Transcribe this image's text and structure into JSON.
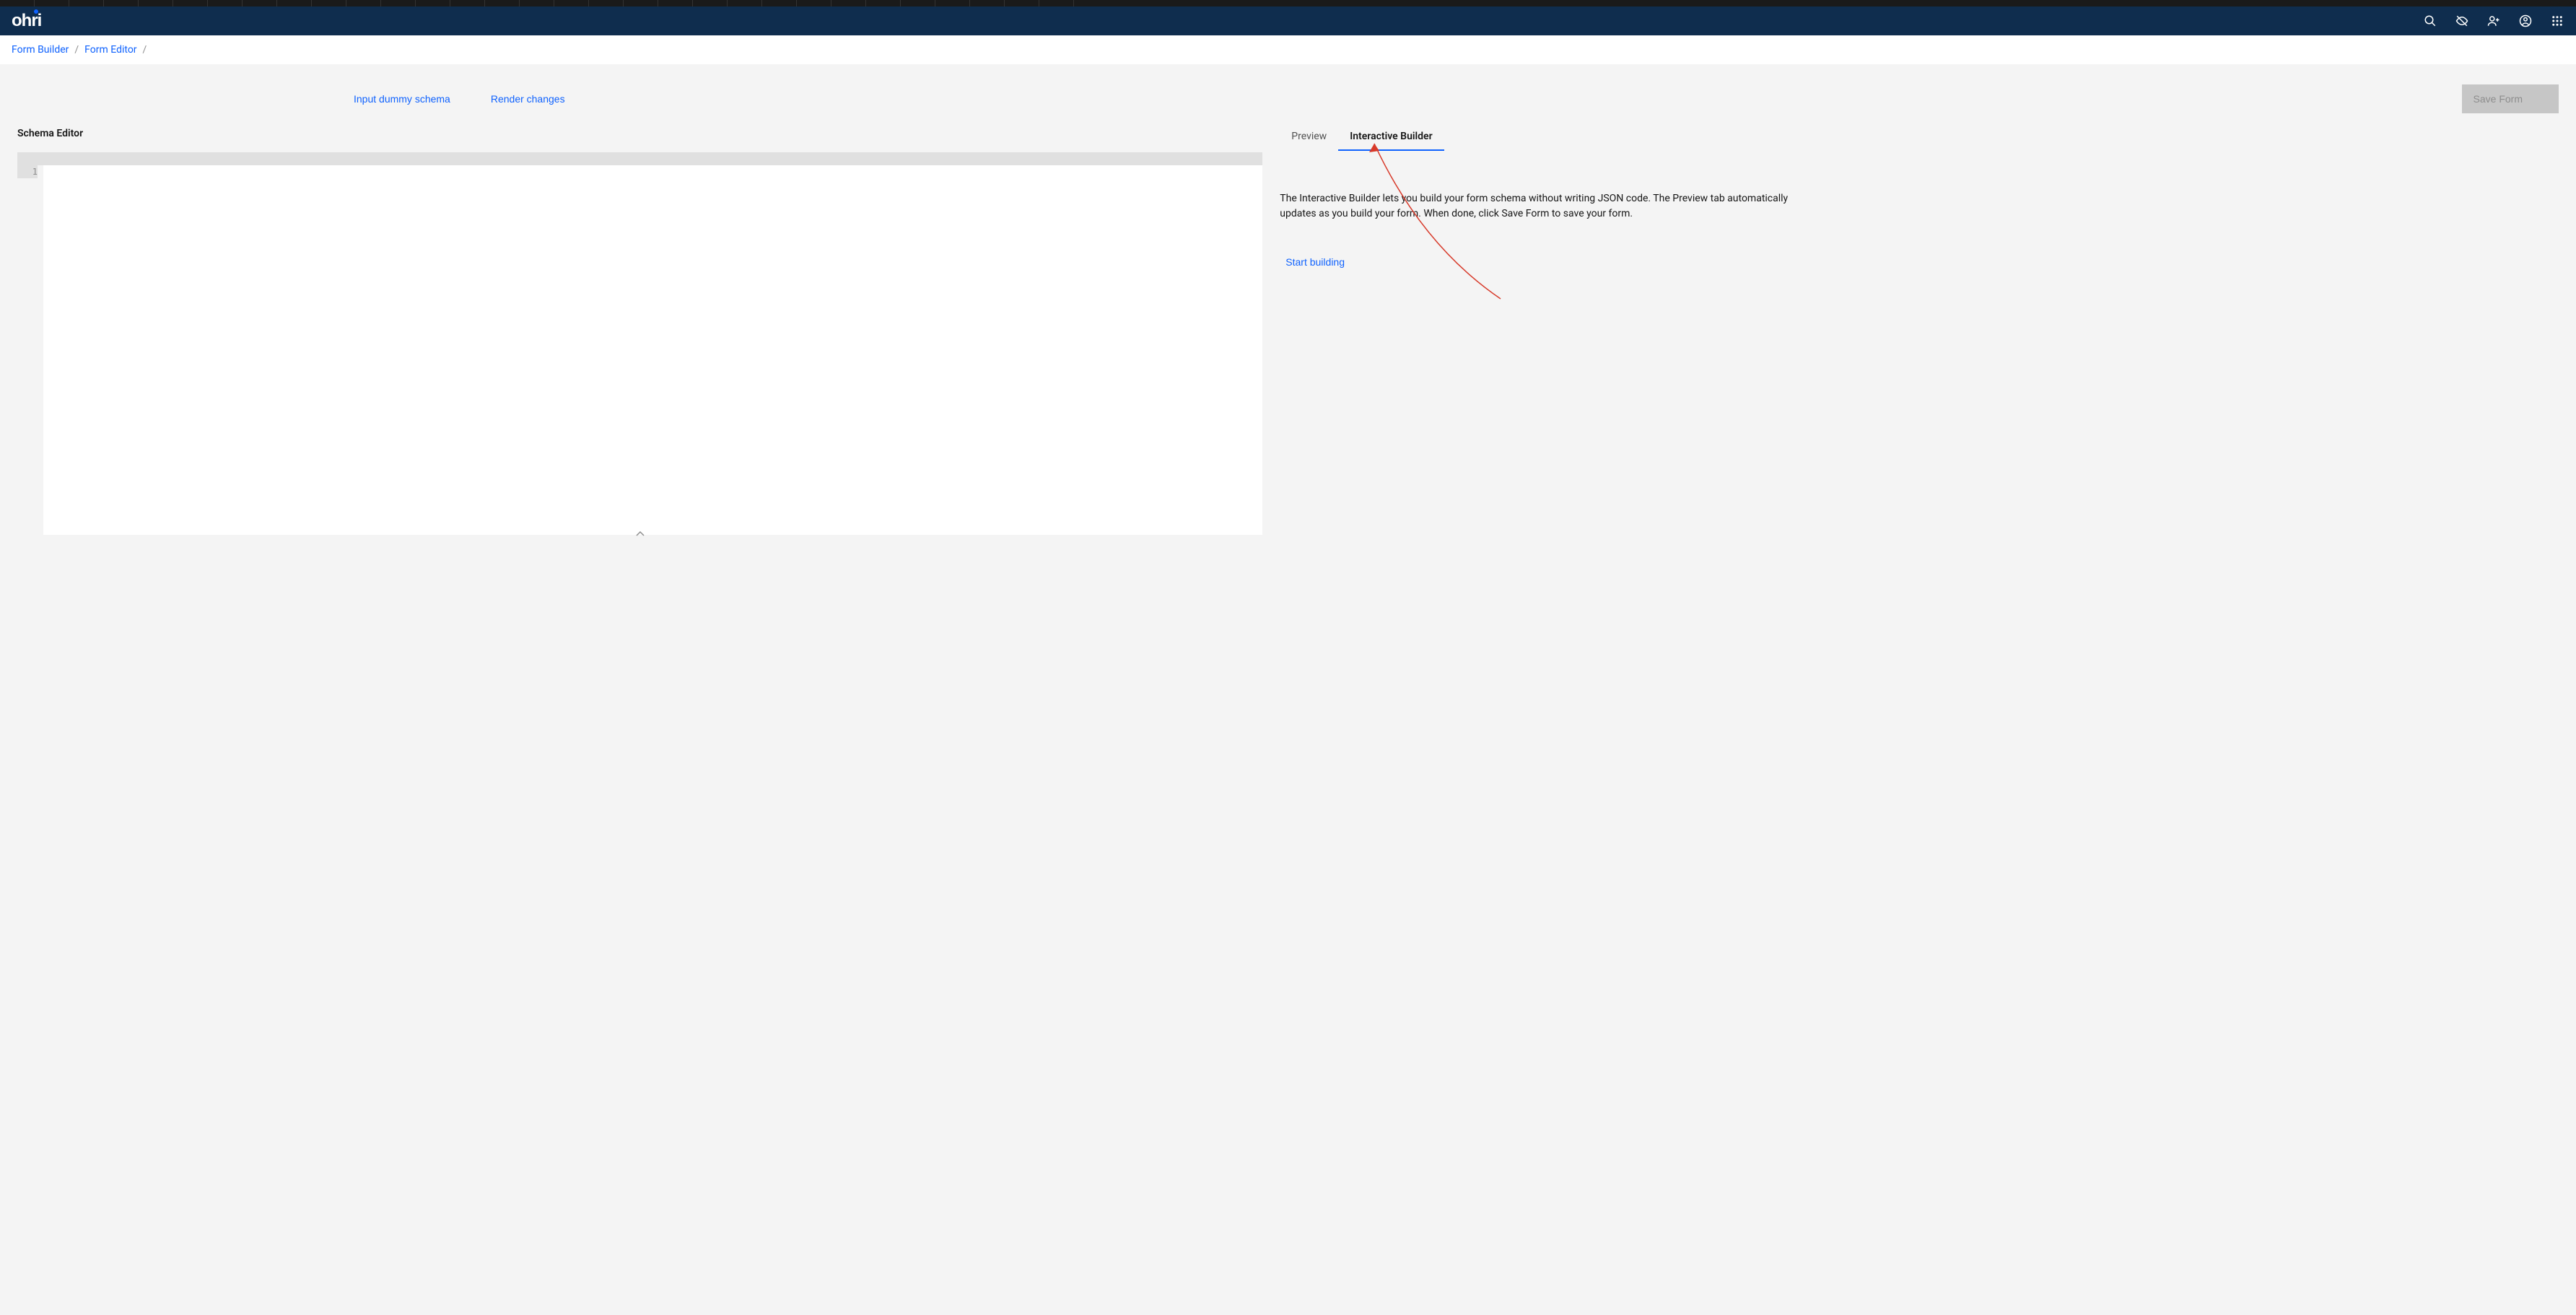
{
  "brand": {
    "name": "ohri"
  },
  "breadcrumbs": [
    {
      "label": "Form Builder"
    },
    {
      "label": "Form Editor"
    }
  ],
  "actions": {
    "input_dummy": "Input dummy schema",
    "render_changes": "Render changes",
    "save_form": "Save Form"
  },
  "left_panel": {
    "title": "Schema Editor",
    "line_number": "1"
  },
  "right_panel": {
    "tabs": {
      "preview": "Preview",
      "interactive": "Interactive Builder"
    },
    "description": "The Interactive Builder lets you build your form schema without writing JSON code. The Preview tab automatically updates as you build your form. When done, click Save Form to save your form.",
    "start_building": "Start building"
  }
}
